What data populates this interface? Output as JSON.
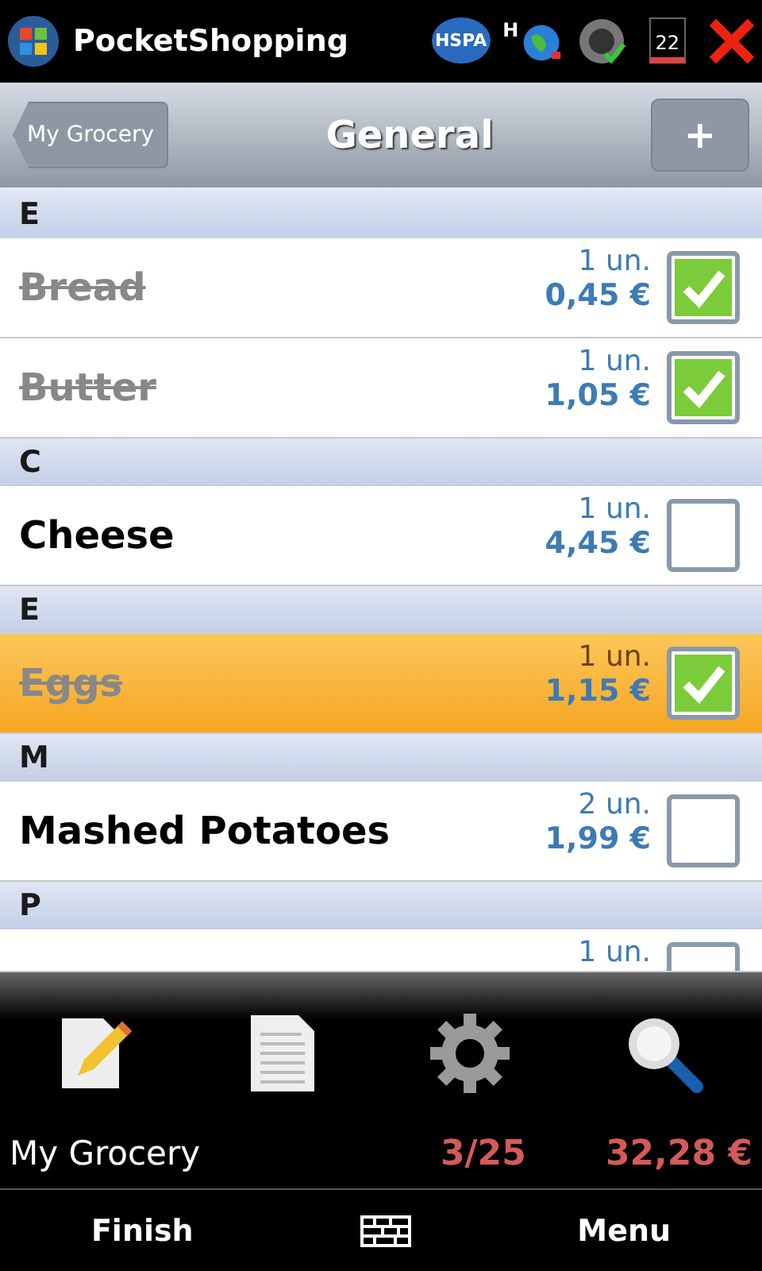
{
  "status_bar": {
    "app_title": "PocketShopping",
    "network_label": "HSPA",
    "data_label": "H",
    "battery_label": "22"
  },
  "header": {
    "back_button": "My Grocery",
    "title": "General",
    "add_button": "+"
  },
  "sections": [
    {
      "letter": "E",
      "items": [
        {
          "name": "Bread",
          "quantity": "1 un.",
          "price": "0,45 €",
          "checked": true,
          "selected": false
        },
        {
          "name": "Butter",
          "quantity": "1 un.",
          "price": "1,05 €",
          "checked": true,
          "selected": false
        }
      ]
    },
    {
      "letter": "C",
      "items": [
        {
          "name": "Cheese",
          "quantity": "1 un.",
          "price": "4,45 €",
          "checked": false,
          "selected": false
        }
      ]
    },
    {
      "letter": "E",
      "items": [
        {
          "name": "Eggs",
          "quantity": "1 un.",
          "price": "1,15 €",
          "checked": true,
          "selected": true
        }
      ]
    },
    {
      "letter": "M",
      "items": [
        {
          "name": "Mashed Potatoes",
          "quantity": "2 un.",
          "price": "1,99 €",
          "checked": false,
          "selected": false
        }
      ]
    },
    {
      "letter": "P",
      "items": [
        {
          "quantity": "1 un.",
          "checked": false,
          "selected": false
        }
      ]
    }
  ],
  "summary": {
    "list_name": "My Grocery",
    "count": "3/25",
    "total": "32,28 €"
  },
  "softkeys": {
    "left": "Finish",
    "right": "Menu"
  }
}
